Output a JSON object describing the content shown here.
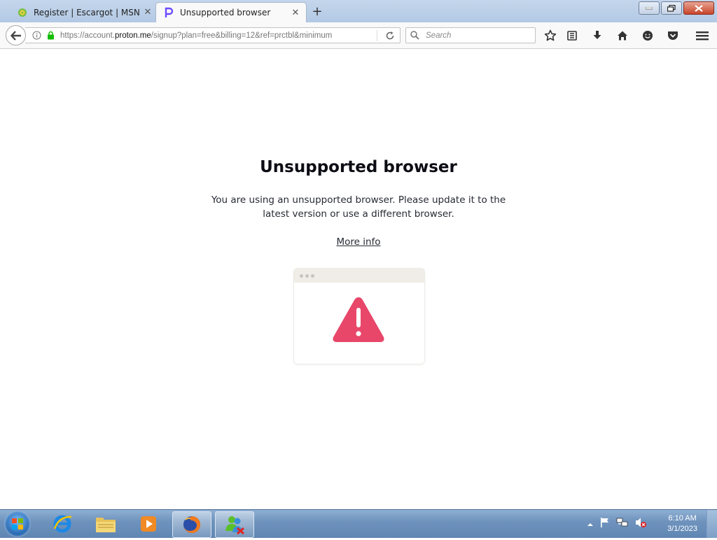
{
  "browser": {
    "tabs": [
      {
        "title": "Register | Escargot | MSN ...",
        "favicon": "escargot-icon",
        "active": false
      },
      {
        "title": "Unsupported browser",
        "favicon": "proton-p-icon",
        "active": true
      }
    ],
    "url": {
      "prefix": "https://account.",
      "domain": "proton.me",
      "path": "/signup?plan=free&billing=12&ref=prctbl&minimum"
    },
    "search_placeholder": "Search"
  },
  "page": {
    "heading": "Unsupported browser",
    "description": "You are using an unsupported browser. Please update it to the latest version or use a different browser.",
    "more_info": "More info",
    "accent_color": "#e8476a"
  },
  "taskbar": {
    "time": "6:10 AM",
    "date": "3/1/2023",
    "pinned": [
      "internet-explorer-icon",
      "file-explorer-icon",
      "media-player-icon",
      "firefox-icon",
      "msn-messenger-icon"
    ]
  }
}
